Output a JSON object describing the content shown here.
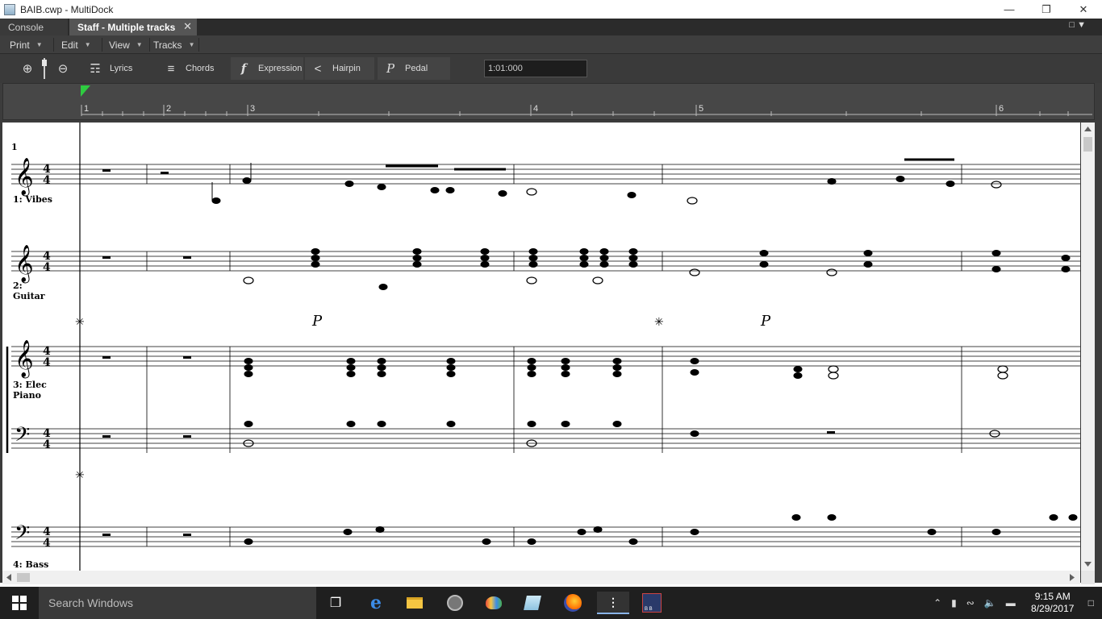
{
  "window": {
    "title": "BAIB.cwp - MultiDock"
  },
  "tabs": {
    "console": "Console",
    "staff": "Staff - Multiple tracks"
  },
  "menu": {
    "print": "Print",
    "edit": "Edit",
    "view": "View",
    "tracks": "Tracks"
  },
  "toolbar": {
    "lyrics": "Lyrics",
    "chords": "Chords",
    "expression": "Expression",
    "hairpin": "Hairpin",
    "pedal": "Pedal",
    "time": "1:01:000"
  },
  "ruler": {
    "m1": "1",
    "m2": "2",
    "m3": "3",
    "m4": "4",
    "m5": "5",
    "m6": "6"
  },
  "score": {
    "measure_number": "1",
    "time_sig_top": "4",
    "time_sig_bottom": "4",
    "tracks": {
      "vibes": "1: Vibes",
      "guitar_num": "2:",
      "guitar_name": "Guitar",
      "elec_piano_1": "3: Elec",
      "elec_piano_2": "Piano",
      "bass": "4: Bass"
    }
  },
  "taskbar": {
    "search": "Search Windows",
    "time": "9:15 AM",
    "date": "8/29/2017",
    "bb_label": "B B"
  }
}
